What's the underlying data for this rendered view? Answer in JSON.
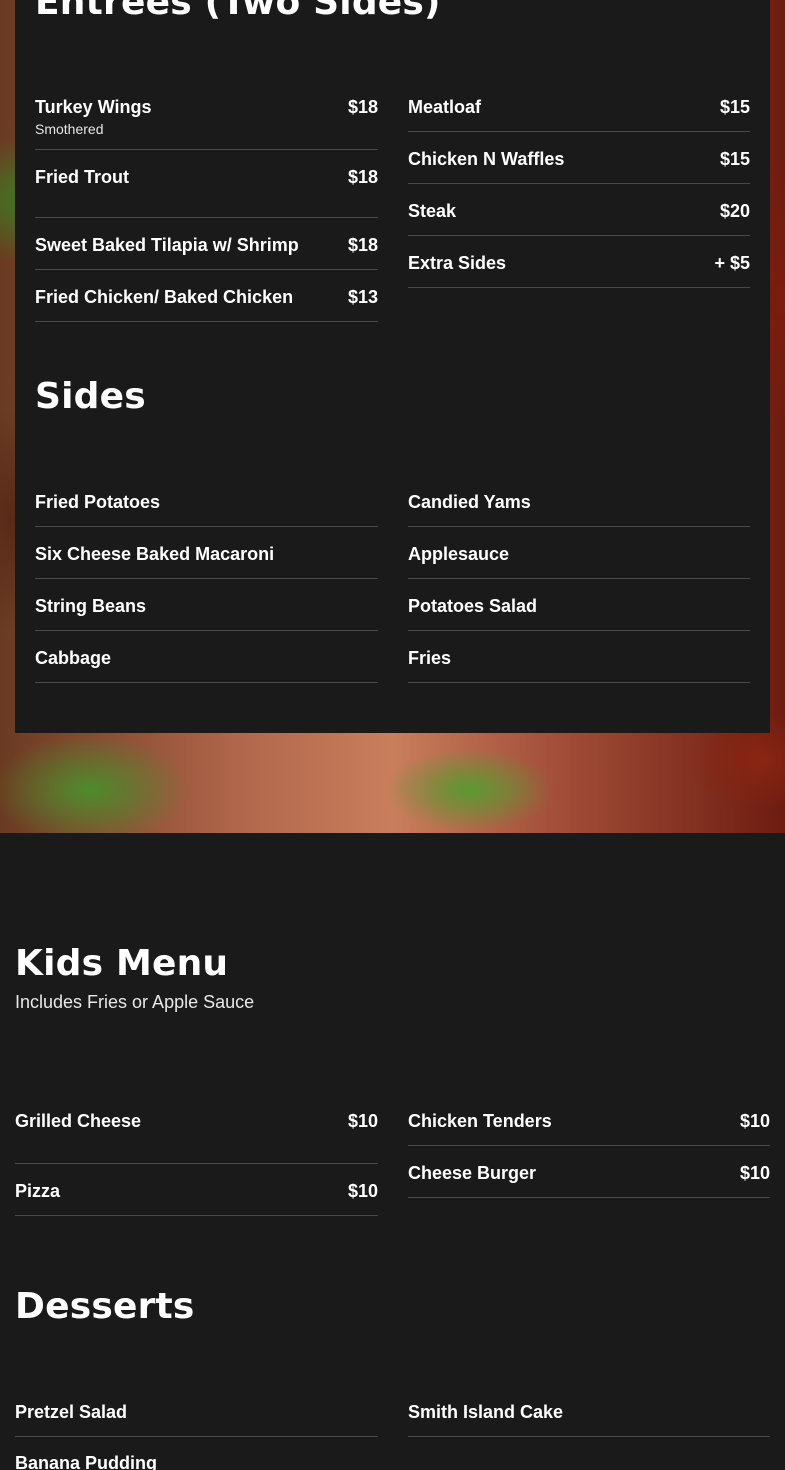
{
  "entrees": {
    "title": "Entrees (Two Sides)",
    "left": [
      {
        "name": "Turkey Wings",
        "desc": "Smothered",
        "price": "$18"
      },
      {
        "name": "Fried Trout",
        "price": "$18"
      },
      {
        "name": "Sweet Baked Tilapia w/ Shrimp",
        "price": "$18"
      },
      {
        "name": "Fried Chicken/ Baked Chicken",
        "price": "$13"
      }
    ],
    "right": [
      {
        "name": "Meatloaf",
        "price": "$15"
      },
      {
        "name": "Chicken N Waffles",
        "price": "$15"
      },
      {
        "name": "Steak",
        "price": "$20"
      },
      {
        "name": "Extra Sides",
        "price": "+ $5"
      }
    ]
  },
  "sides": {
    "title": "Sides",
    "left": [
      {
        "name": "Fried Potatoes"
      },
      {
        "name": "Six Cheese Baked Macaroni"
      },
      {
        "name": "String Beans"
      },
      {
        "name": "Cabbage"
      }
    ],
    "right": [
      {
        "name": "Candied Yams"
      },
      {
        "name": "Applesauce"
      },
      {
        "name": "Potatoes Salad"
      },
      {
        "name": "Fries"
      }
    ]
  },
  "kids": {
    "title": "Kids Menu",
    "subtitle": "Includes Fries or Apple Sauce",
    "left": [
      {
        "name": "Grilled Cheese",
        "price": "$10"
      },
      {
        "name": "Pizza",
        "price": "$10"
      }
    ],
    "right": [
      {
        "name": "Chicken Tenders",
        "price": "$10"
      },
      {
        "name": "Cheese Burger",
        "price": "$10"
      }
    ]
  },
  "desserts": {
    "title": "Desserts",
    "left": [
      {
        "name": "Pretzel Salad"
      },
      {
        "name": "Banana Pudding"
      }
    ],
    "right": [
      {
        "name": "Smith Island Cake"
      }
    ]
  }
}
